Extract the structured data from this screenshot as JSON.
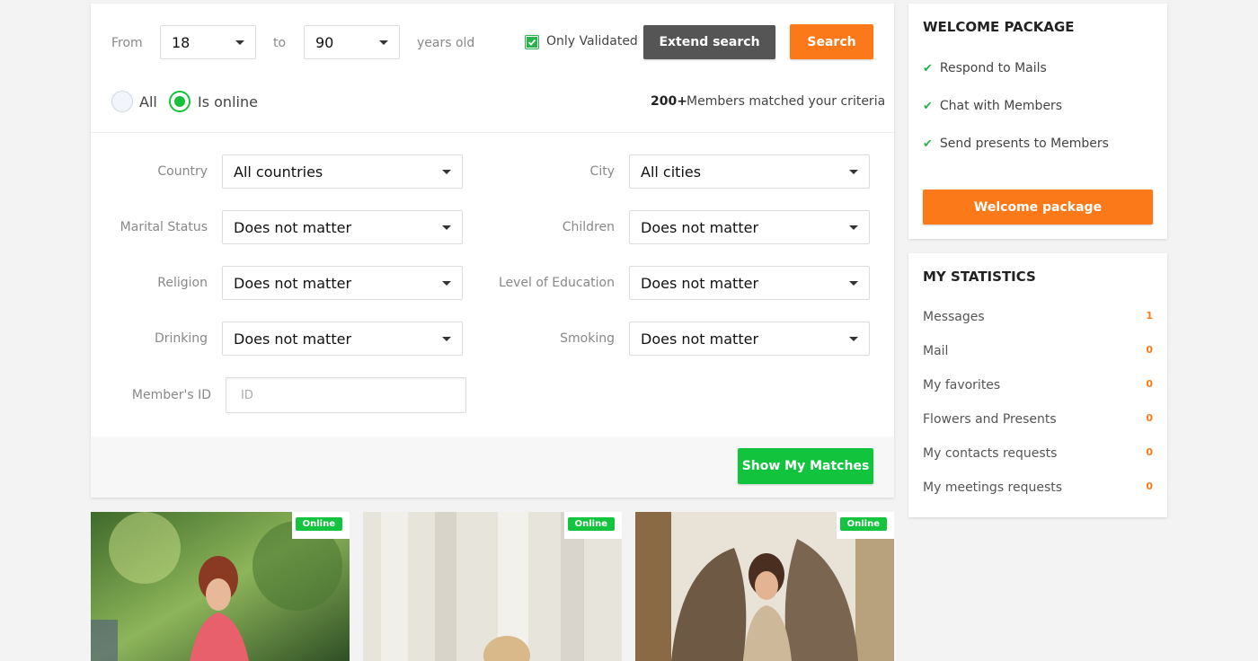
{
  "search": {
    "from_label": "From",
    "from_value": "18",
    "to_label": "to",
    "to_value": "90",
    "years_label": "years old",
    "only_validated_label": "Only Validated",
    "only_validated_checked": true,
    "extend_search_label": "Extend search",
    "search_label": "Search",
    "radio_all_label": "All",
    "radio_online_label": "Is online",
    "selected_radio": "Is online",
    "matched_count": "200+",
    "matched_text": "Members matched your criteria"
  },
  "filters": {
    "country_label": "Country",
    "country_value": "All countries",
    "city_label": "City",
    "city_value": "All cities",
    "marital_label": "Marital Status",
    "marital_value": "Does not matter",
    "children_label": "Children",
    "children_value": "Does not matter",
    "religion_label": "Religion",
    "religion_value": "Does not matter",
    "education_label": "Level of Education",
    "education_value": "Does not matter",
    "drinking_label": "Drinking",
    "drinking_value": "Does not matter",
    "smoking_label": "Smoking",
    "smoking_value": "Does not matter",
    "member_id_label": "Member's ID",
    "member_id_placeholder": "ID",
    "show_matches_label": "Show My Matches"
  },
  "welcome": {
    "title": "WELCOME PACKAGE",
    "features": [
      "Respond to Mails",
      "Chat with Members",
      "Send presents to Members"
    ],
    "button_label": "Welcome package"
  },
  "statistics": {
    "title": "MY STATISTICS",
    "items": [
      {
        "label": "Messages",
        "value": "1"
      },
      {
        "label": "Mail",
        "value": "0"
      },
      {
        "label": "My favorites",
        "value": "0"
      },
      {
        "label": "Flowers and Presents",
        "value": "0"
      },
      {
        "label": "My contacts requests",
        "value": "0"
      },
      {
        "label": "My meetings requests",
        "value": "0"
      }
    ]
  },
  "profiles": [
    {
      "badge": "Online"
    },
    {
      "badge": "Online"
    },
    {
      "badge": "Online"
    }
  ],
  "colors": {
    "accent_orange": "#fb7918",
    "accent_green": "#12c43d",
    "button_gray": "#555555"
  }
}
